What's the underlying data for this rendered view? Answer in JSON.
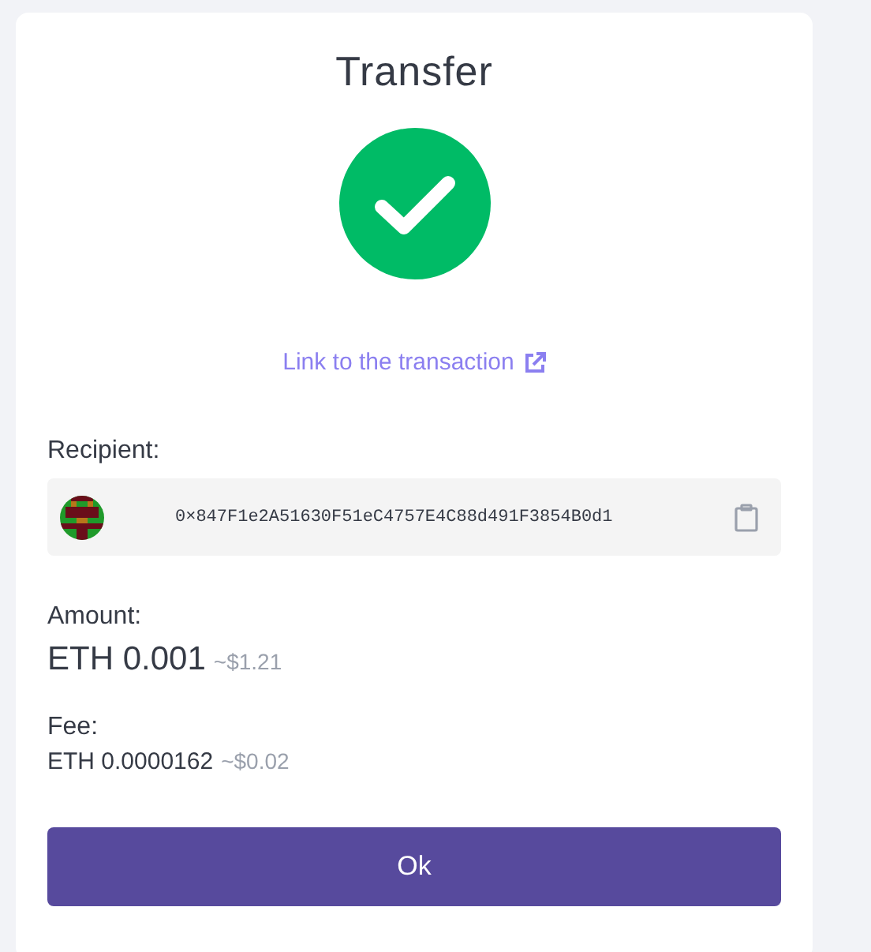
{
  "title": "Transfer",
  "link": {
    "label": "Link to the transaction"
  },
  "recipient": {
    "label": "Recipient:",
    "address": "0×847F1e2A51630F51eC4757E4C88d491F3854B0d1"
  },
  "amount": {
    "label": "Amount:",
    "value": "ETH 0.001",
    "fiat": "~$1.21"
  },
  "fee": {
    "label": "Fee:",
    "value": "ETH 0.0000162",
    "fiat": "~$0.02"
  },
  "button": {
    "label": "Ok"
  }
}
